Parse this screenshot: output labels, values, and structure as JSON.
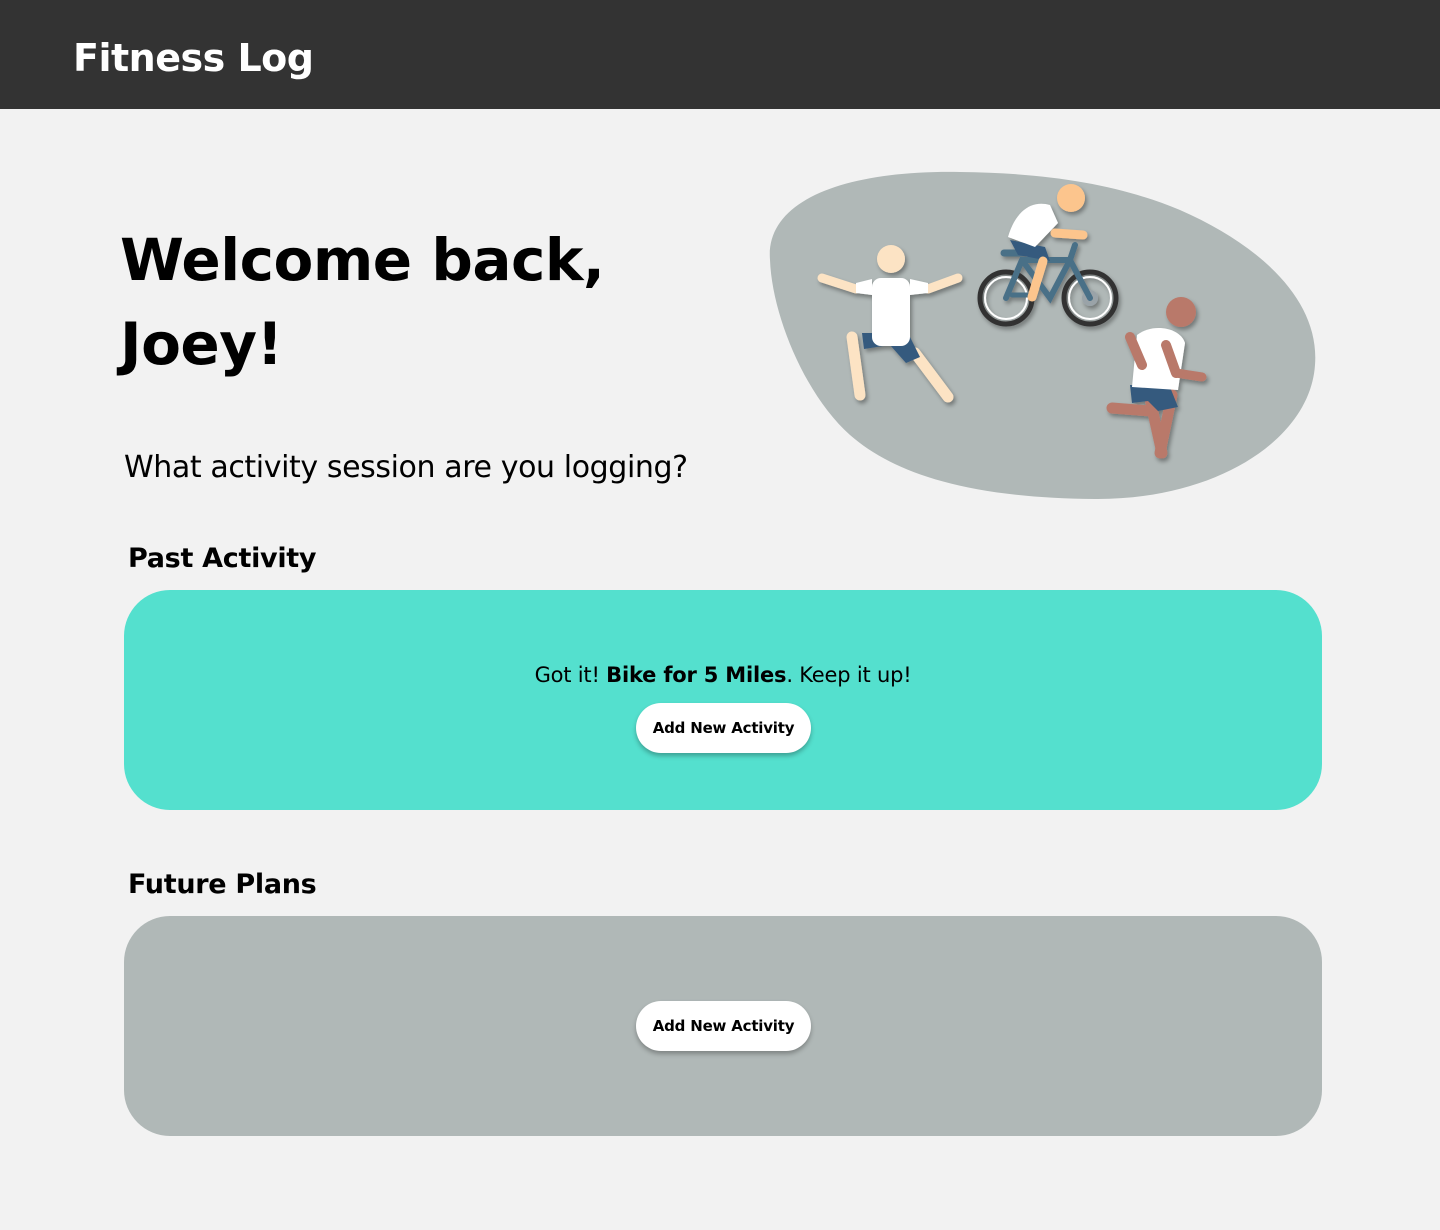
{
  "header": {
    "title": "Fitness Log"
  },
  "welcome": {
    "line1": "Welcome back,",
    "line2": "Joey!",
    "prompt": "What activity session are you logging?"
  },
  "past_activity": {
    "title": "Past Activity",
    "message_prefix": "Got it! ",
    "message_activity": "Bike for 5 Miles",
    "message_suffix": ". Keep it up!",
    "button_label": "Add New Activity",
    "color": "#54e0ce"
  },
  "future_plans": {
    "title": "Future Plans",
    "button_label": "Add New Activity",
    "color": "#b0b8b7"
  },
  "illustration": {
    "icons": [
      "stretching-person-icon",
      "cyclist-icon",
      "runner-icon"
    ],
    "colors": {
      "blob": "#b0b8b7",
      "skin_light": "#fce3c4",
      "skin_peach": "#fcc58d",
      "skin_brown": "#b9796a",
      "shorts": "#345a7e",
      "bike": "#4a6f87"
    }
  }
}
